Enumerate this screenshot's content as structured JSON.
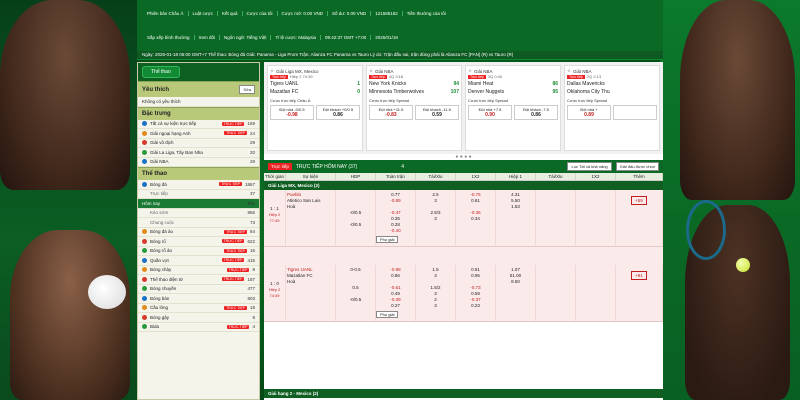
{
  "nav": {
    "top_items": [
      "Phiên bản Châu Á",
      "Luật cược",
      "Kết quả",
      "Cược của tôi",
      "Cược mở: 0.00 VND",
      "Số dư: 0.00 VND",
      "121586182",
      "Tiền thưởng của tôi"
    ],
    "second_items": [
      "Sắp xếp bình thường",
      "Xem đôi",
      "Ngôn ngữ: Tiếng Việt",
      "Tỉ lệ cược: Malaysia",
      "09:42:37 GMT +7:00",
      "2025/01/18"
    ]
  },
  "ticker": "Ngày: 2025-01-18 05:00 GMT+7 Thể thao: Bóng đá Giải: Panama - Liga Prom Trận: Alianza FC Panama vs Tauro Lý do: Trận đấu sai, trận đúng phải là Alianza FC [PAN] (R) vs Tauro (R)",
  "sidebar": {
    "sport_button": "Thể thao",
    "favorites_title": "Yêu thích",
    "favorites_btn": "Sửa",
    "no_favorites": "Không có yêu thích",
    "featured_title": "Đặc trưng",
    "featured": [
      {
        "label": "Tất cả sự kiện trực tiếp",
        "badge": "TRỰC TIẾP",
        "count": "169"
      },
      {
        "label": "Giải ngoại hạng Anh",
        "badge": "TRỰC TIẾP",
        "count": "24"
      },
      {
        "label": "Giải vô địch",
        "badge": "",
        "count": "29"
      },
      {
        "label": "Giải La Liga, Tây Ban Nha",
        "badge": "",
        "count": "20"
      },
      {
        "label": "Giải NBA",
        "badge": "",
        "count": "28"
      }
    ],
    "sports_title": "Thể thao",
    "sports": [
      {
        "label": "Bóng đá",
        "badge": "TRỰC TIẾP",
        "count": "1867",
        "type": "main"
      },
      {
        "label": "Trực tiếp",
        "badge": "",
        "count": "37",
        "type": "sub"
      },
      {
        "label": "Hôm nay",
        "badge": "",
        "count": "901",
        "type": "active"
      },
      {
        "label": "Kèo sớm",
        "badge": "",
        "count": "856",
        "type": "sub"
      },
      {
        "label": "Chung cuộc",
        "badge": "",
        "count": "73",
        "type": "sub"
      },
      {
        "label": "Bóng đá ảo",
        "badge": "TRỰC TIẾP",
        "count": "84",
        "type": "main"
      },
      {
        "label": "Bóng rổ",
        "badge": "TRỰC TIẾP",
        "count": "622",
        "type": "main"
      },
      {
        "label": "Bóng rổ ảo",
        "badge": "TRỰC TIẾP",
        "count": "16",
        "type": "main"
      },
      {
        "label": "Quần vợt",
        "badge": "TRỰC TIẾP",
        "count": "415",
        "type": "main"
      },
      {
        "label": "Bóng chày",
        "badge": "TRỰC TIẾP",
        "count": "8",
        "type": "main"
      },
      {
        "label": "Thể thao điện tử",
        "badge": "TRỰC TIẾP",
        "count": "187",
        "type": "main"
      },
      {
        "label": "Bóng chuyền",
        "badge": "",
        "count": "477",
        "type": "main"
      },
      {
        "label": "Bóng bàn",
        "badge": "",
        "count": "803",
        "type": "main"
      },
      {
        "label": "Cầu lông",
        "badge": "TRỰC TIẾP",
        "count": "18",
        "type": "main"
      },
      {
        "label": "Bóng gậy",
        "badge": "",
        "count": "8",
        "type": "main"
      },
      {
        "label": "Bida",
        "badge": "TRỰC TIẾP",
        "count": "4",
        "type": "main"
      }
    ]
  },
  "cards": [
    {
      "league": "Giải Liga MX, Mexico",
      "time": "Hiệp 2 74:39",
      "team1": "Tigres UANL",
      "s1": "1",
      "team2": "Mazatlan FC",
      "s2": "0",
      "market": "Cược trực tiếp Châu Á",
      "o1l": "Đội nhà -0/0.5",
      "o1": "-0.98",
      "o2l": "Đội khách +0/0.5",
      "o2": "0.86"
    },
    {
      "league": "Giải NBA",
      "time": "4Q 3:18",
      "team1": "New York Knicks",
      "s1": "94",
      "team2": "Minnesota Timberwolves",
      "s2": "107",
      "market": "Cược trực tiếp Spread",
      "o1l": "Đội nhà +11.5",
      "o1": "-0.83",
      "o2l": "Đội khách -11.5",
      "o2": "0.59"
    },
    {
      "league": "Giải NBA",
      "time": "3Q 0:40",
      "team1": "Miami Heat",
      "s1": "86",
      "team2": "Denver Nuggets",
      "s2": "95",
      "market": "Cược trực tiếp Spread",
      "o1l": "Đội nhà +7.5",
      "o1": "0.90",
      "o2l": "Đội khách -7.5",
      "o2": "0.86"
    },
    {
      "league": "Giải NBA",
      "time": "2Q 2:13",
      "team1": "Dallas Mavericks",
      "s1": "",
      "team2": "Oklahoma City Thu",
      "s2": "",
      "market": "Cược trực tiếp Spread",
      "o1l": "Đội nhà +",
      "o1": "0.89",
      "o2l": "",
      "o2": ""
    }
  ],
  "table": {
    "tab_live": "Trực tiếp",
    "title": "TRỰC TIẾP HÔM NAY (37)",
    "refresh": "4",
    "filter": "Lọc Tất cả khả năng",
    "btn_selected": "Giải đấu được chọn",
    "group_full": "Toàn trận",
    "group_half": "Hiệp 1",
    "col_time": "Thời gian",
    "col_event": "Sự kiện",
    "col_hdp": "HDP",
    "col_ou": "Tài/Xỉu",
    "col_1x2": "1X2",
    "col_more": "Thêm",
    "league1": "Giải Liga MX, Mexico (2)",
    "league2": "Giải hạng 2 - Mexico (2)",
    "more_label": "Phụ giải",
    "matches": [
      {
        "score": "1 : 1",
        "period": "Hiệp 2 77:49",
        "home": "Puebla",
        "away": "Atletico San Luis",
        "draw": "Hoà",
        "rows": [
          [
            "",
            "0.77",
            "2.5",
            "-0.75",
            "4.31"
          ],
          [
            "",
            "-0.89",
            "3",
            "0.61",
            "5.50"
          ],
          [
            "",
            "",
            "",
            "",
            "1.53"
          ],
          [
            "-0/0.5",
            "-0.47",
            "2.5/3",
            "-0.36",
            ""
          ],
          [
            "",
            "0.35",
            "3",
            "0.34",
            ""
          ],
          [
            "-0/0.5",
            "0.28",
            "",
            "",
            ""
          ],
          [
            "",
            "-0.40",
            "",
            "",
            ""
          ]
        ],
        "plus": "+59"
      },
      {
        "score": "1 : 0",
        "period": "Hiệp 2 74:39",
        "home": "Tigres UANL",
        "away": "Mazatlan FC",
        "draw": "Hoà",
        "rows": [
          [
            "0-0.5",
            "-0.98",
            "1.5",
            "0.91",
            "1.07"
          ],
          [
            "",
            "0.86",
            "3",
            "0.95",
            "51.00"
          ],
          [
            "",
            "",
            "",
            "",
            "8.50"
          ],
          [
            "0.5",
            "-0.61",
            "1.5/2",
            "-0.73",
            ""
          ],
          [
            "",
            "0.49",
            "3",
            "0.59",
            ""
          ],
          [
            "-0/0.5",
            "-0.39",
            "2",
            "-0.37",
            ""
          ],
          [
            "",
            "0.27",
            "3",
            "0.23",
            ""
          ]
        ],
        "plus": "+81"
      }
    ]
  },
  "colors": {
    "brand": "#0a6a25",
    "live": "#ee2222",
    "negative": "#c21e1e"
  }
}
